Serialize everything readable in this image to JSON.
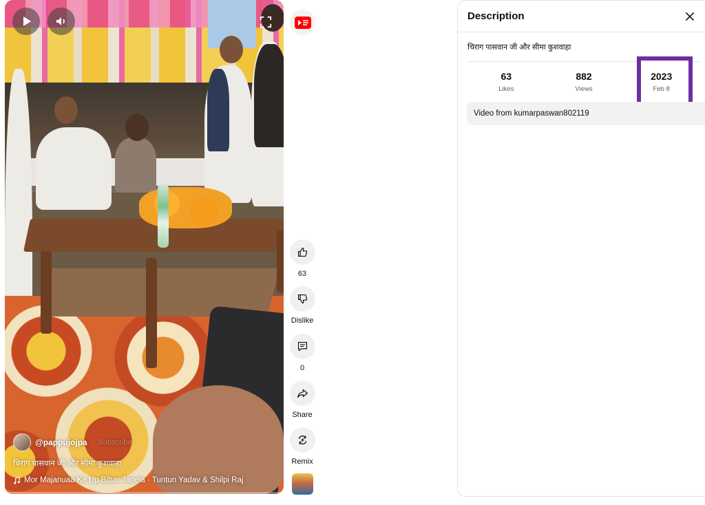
{
  "player": {
    "channel_handle": "@pappujojpa",
    "subscribe_label": "Subscribe",
    "video_title": "चिराग पासवान जी और सीमा कुशवाहा",
    "music": "Mor Majanuaa Ke Up Bihar Janela · Tuntun Yadav & Shilpi Raj",
    "icons": {
      "play": "play-icon",
      "volume": "volume-icon",
      "fullscreen": "fullscreen-icon",
      "music": "music-note-icon"
    }
  },
  "rail": {
    "top_icon": "youtube-shorts-icon",
    "actions": [
      {
        "icon": "thumbs-up-icon",
        "label": "63"
      },
      {
        "icon": "thumbs-down-icon",
        "label": "Dislike"
      },
      {
        "icon": "comment-icon",
        "label": "0"
      },
      {
        "icon": "share-icon",
        "label": "Share"
      },
      {
        "icon": "remix-icon",
        "label": "Remix"
      }
    ]
  },
  "description_panel": {
    "title": "Description",
    "text": "चिराग पासवान जी और सीमा कुशवाहा",
    "stats": [
      {
        "value": "63",
        "label": "Likes"
      },
      {
        "value": "882",
        "label": "Views"
      },
      {
        "value": "2023",
        "label": "Feb 8"
      }
    ],
    "source": "Video from kumarpaswan802119",
    "highlight_color": "#6b2fa0"
  }
}
